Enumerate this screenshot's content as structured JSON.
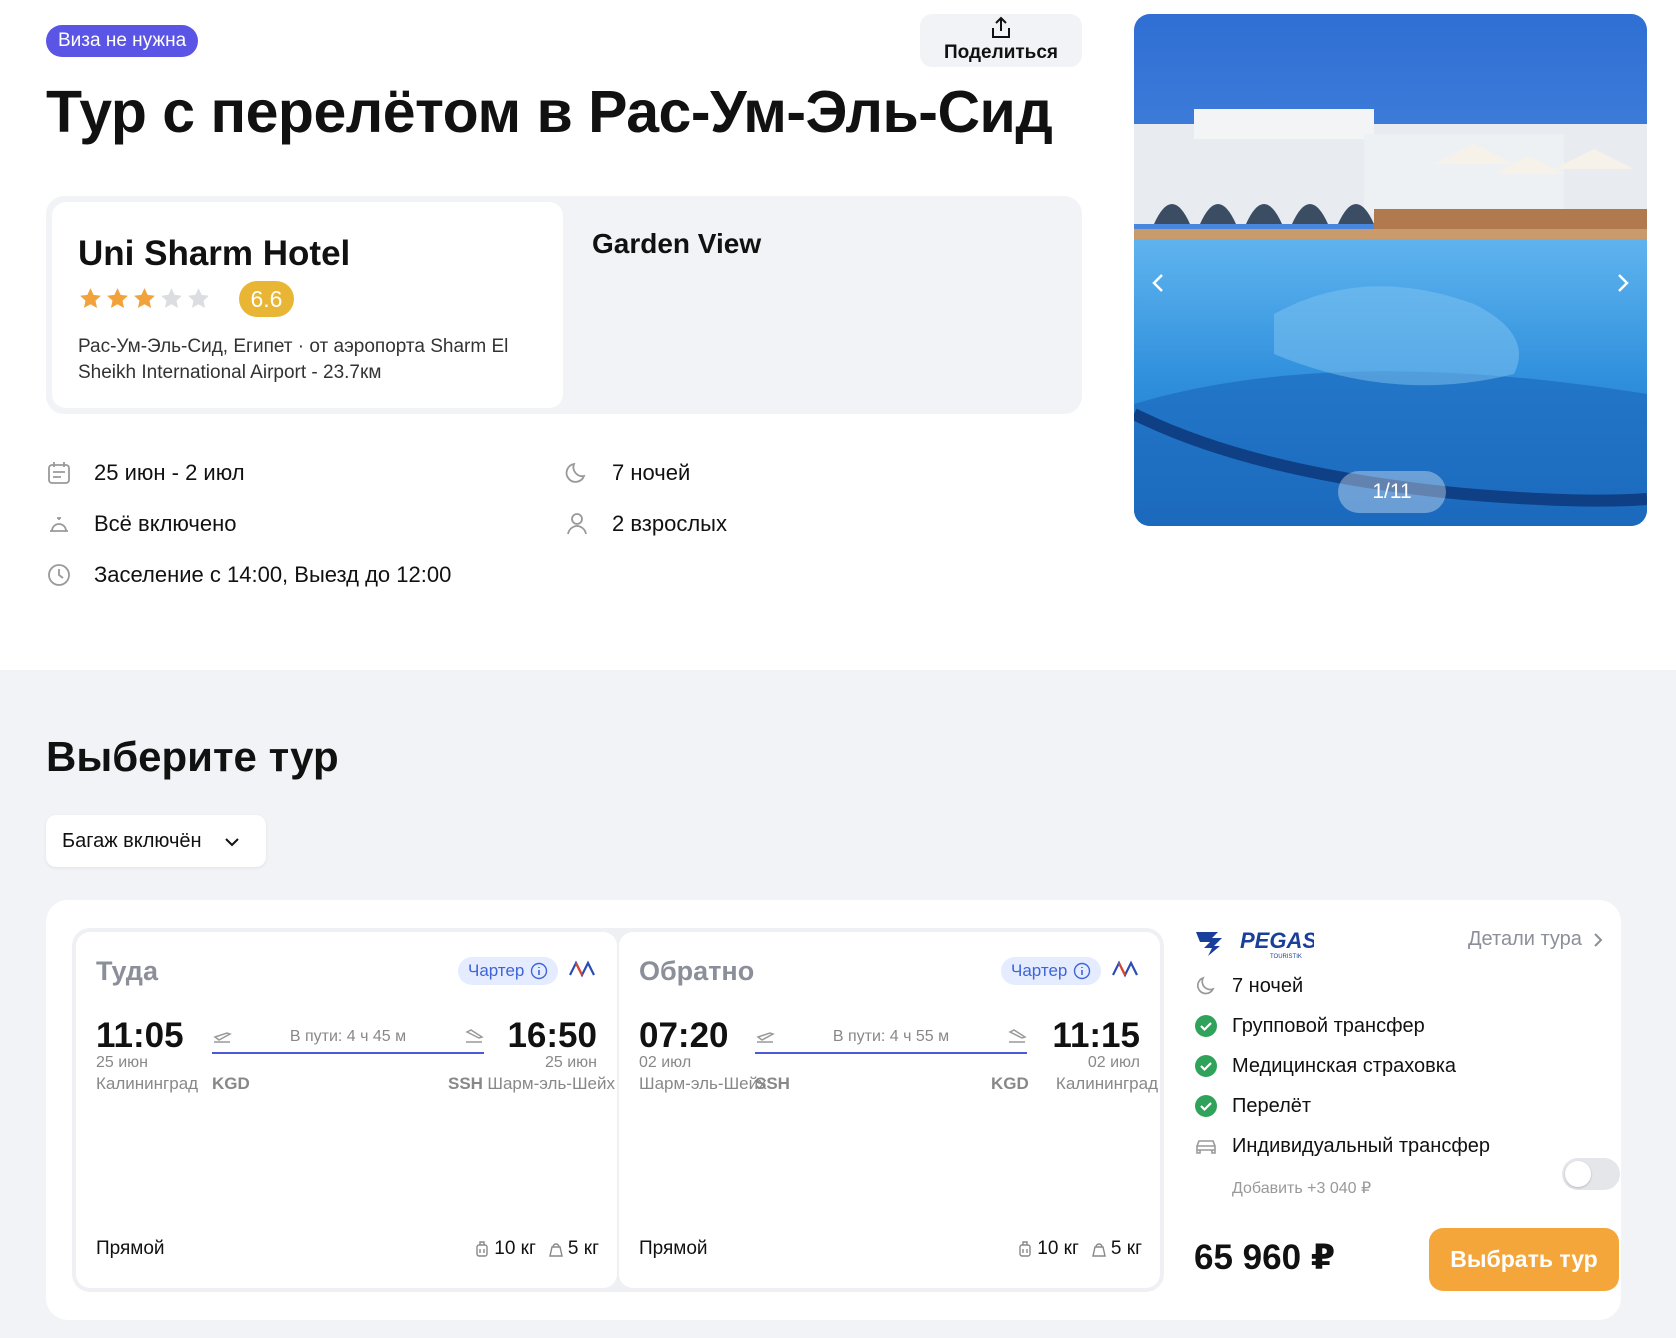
{
  "header": {
    "visa_badge": "Виза не нужна",
    "share_label": "Поделиться",
    "title": "Тур с перелётом в Рас-Ум-Эль-Сид"
  },
  "hotel": {
    "name": "Uni Sharm Hotel",
    "stars": 3,
    "stars_max": 5,
    "rating": "6.6",
    "location": "Рас-Ум-Эль-Сид, Египет · от аэропорта Sharm El Sheikh International Airport - 23.7км",
    "room": "Garden View"
  },
  "facts": {
    "dates": "25 июн - 2 июл",
    "nights": "7 ночей",
    "meals": "Всё включено",
    "guests": "2 взрослых",
    "checkin": "Заселение с 14:00, Выезд до 12:00"
  },
  "gallery": {
    "counter": "1/11"
  },
  "tours": {
    "section_title": "Выберите тур",
    "filter_label": "Багаж включён"
  },
  "offer": {
    "outbound": {
      "direction": "Туда",
      "charter": "Чартер",
      "dep_time": "11:05",
      "dep_date": "25 июн",
      "dep_city": "Калининград",
      "dep_iata": "KGD",
      "duration": "В пути: 4 ч 45 м",
      "arr_time": "16:50",
      "arr_date": "25 июн",
      "arr_city": "Шарм-эль-Шейх",
      "arr_iata": "SSH",
      "type": "Прямой",
      "bag1": "10 кг",
      "bag2": "5 кг"
    },
    "return": {
      "direction": "Обратно",
      "charter": "Чартер",
      "dep_time": "07:20",
      "dep_date": "02 июл",
      "dep_city": "Шарм-эль-Шейх",
      "dep_iata": "SSH",
      "duration": "В пути: 4 ч 55 м",
      "arr_time": "11:15",
      "arr_date": "02 июл",
      "arr_city": "Калининград",
      "arr_iata": "KGD",
      "type": "Прямой",
      "bag1": "10 кг",
      "bag2": "5 кг"
    },
    "operator": "PEGAS",
    "operator_sub": "TOURISTIK",
    "details_link": "Детали тура",
    "nights": "7 ночей",
    "included": [
      "Групповой трансфер",
      "Медицинская страховка",
      "Перелёт"
    ],
    "addon_label": "Индивидуальный трансфер",
    "addon_price": "Добавить +3 040 ₽",
    "addon_enabled": false,
    "price": "65 960 ₽",
    "select_label": "Выбрать тур"
  },
  "colors": {
    "accent": "#5b55e6",
    "button": "#f4a63b",
    "rating": "#e8b634",
    "check": "#2fa35a",
    "star": "#f2a23a"
  }
}
